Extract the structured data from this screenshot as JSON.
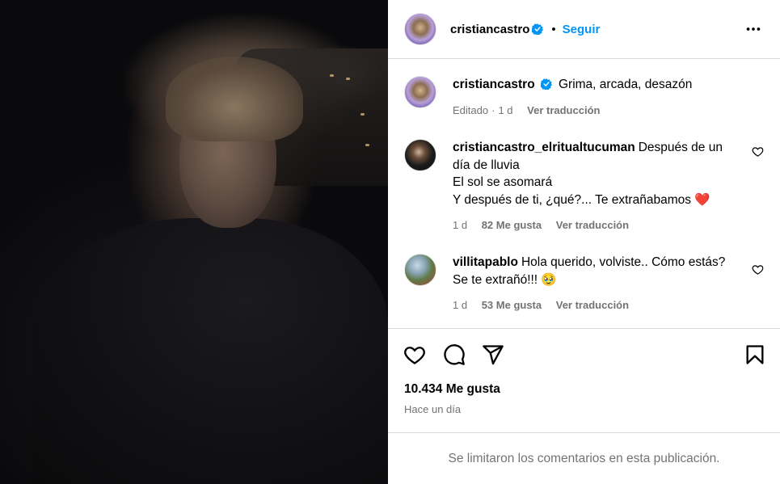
{
  "post": {
    "author": "cristiancastro",
    "follow_label": "Seguir",
    "separator": "•"
  },
  "caption": {
    "username": "cristiancastro",
    "text": "Grima, arcada, desazón",
    "edited": "Editado",
    "meta_dot": "·",
    "age": "1 d",
    "translate": "Ver traducción"
  },
  "comments": [
    {
      "username": "cristiancastro_elritualtucuman",
      "lines": [
        "Después de un",
        "día de lluvia",
        "El sol se asomará",
        "Y después de ti, ¿qué?... Te extrañabamos ❤️"
      ],
      "line0_tail": "Después de un",
      "age": "1 d",
      "likes": "82 Me gusta",
      "translate": "Ver traducción"
    },
    {
      "username": "villitapablo",
      "text_first": "Hola querido, volviste.. Cómo estás?",
      "text_second": "Se te extrañó!!! 🥹",
      "age": "1 d",
      "likes": "53 Me gusta",
      "translate": "Ver traducción"
    }
  ],
  "stats": {
    "likes": "10.434 Me gusta",
    "posted": "Hace un día"
  },
  "footer": {
    "notice": "Se limitaron los comentarios en esta publicación."
  },
  "icons": {
    "verified": "verified-badge-icon",
    "more": "more-options-icon",
    "like": "heart-icon",
    "comment": "comment-icon",
    "share": "share-icon",
    "save": "bookmark-icon"
  },
  "colors": {
    "accent": "#0095f6",
    "verified": "#0095f6",
    "muted": "#737373",
    "heart_emoji": "#ed4956"
  }
}
